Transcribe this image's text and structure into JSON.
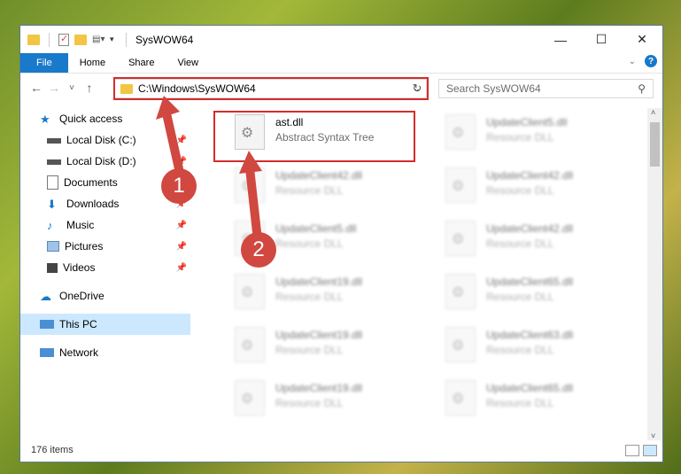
{
  "window": {
    "title": "SysWOW64",
    "controls": {
      "minimize": "—",
      "maximize": "☐",
      "close": "✕"
    }
  },
  "ribbon": {
    "tabs": [
      {
        "label": "File"
      },
      {
        "label": "Home"
      },
      {
        "label": "Share"
      },
      {
        "label": "View"
      }
    ],
    "help": "?"
  },
  "nav": {
    "back": "←",
    "forward": "→",
    "recent": "˅",
    "up": "↑",
    "address": "C:\\Windows\\SysWOW64",
    "refresh": "↻",
    "search_placeholder": "Search SysWOW64"
  },
  "sidebar": {
    "items": [
      {
        "label": "Quick access"
      },
      {
        "label": "Local Disk (C:)"
      },
      {
        "label": "Local Disk (D:)"
      },
      {
        "label": "Documents"
      },
      {
        "label": "Downloads"
      },
      {
        "label": "Music"
      },
      {
        "label": "Pictures"
      },
      {
        "label": "Videos"
      },
      {
        "label": "OneDrive"
      },
      {
        "label": "This PC"
      },
      {
        "label": "Network"
      }
    ]
  },
  "files": [
    {
      "name": "ast.dll",
      "desc": "Abstract Syntax Tree"
    },
    {
      "name": "UpdateClient5.dll",
      "desc": "Resource DLL"
    },
    {
      "name": "UpdateClient42.dll",
      "desc": "Resource DLL"
    },
    {
      "name": "UpdateClient42.dll",
      "desc": "Resource DLL"
    },
    {
      "name": "UpdateClient5.dll",
      "desc": "Resource DLL"
    },
    {
      "name": "UpdateClient42.dll",
      "desc": "Resource DLL"
    },
    {
      "name": "UpdateClient19.dll",
      "desc": "Resource DLL"
    },
    {
      "name": "UpdateClient65.dll",
      "desc": "Resource DLL"
    },
    {
      "name": "UpdateClient19.dll",
      "desc": "Resource DLL"
    },
    {
      "name": "UpdateClient63.dll",
      "desc": "Resource DLL"
    },
    {
      "name": "UpdateClient19.dll",
      "desc": "Resource DLL"
    },
    {
      "name": "UpdateClient65.dll",
      "desc": "Resource DLL"
    }
  ],
  "status": {
    "count": "176 items"
  },
  "annotations": {
    "one": "1",
    "two": "2"
  },
  "colors": {
    "accent": "#1979ca",
    "highlight": "#d42c2c",
    "badge": "#d04840"
  }
}
